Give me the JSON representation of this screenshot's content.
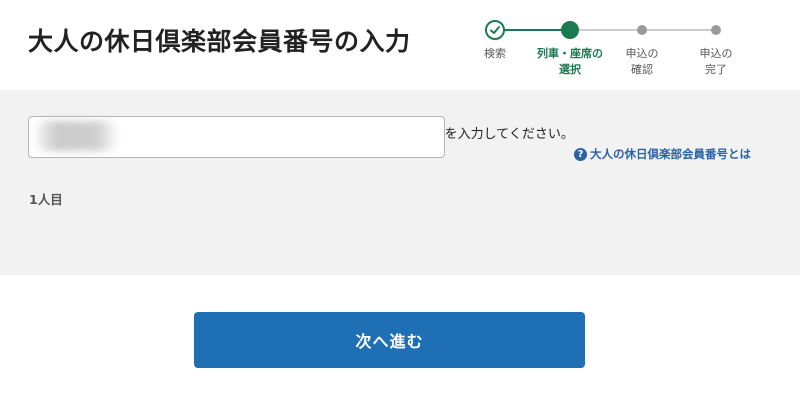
{
  "header": {
    "title": "大人の休日倶楽部会員番号の入力"
  },
  "stepper": {
    "accent_color": "#1a7a52",
    "steps": [
      {
        "label": "検索",
        "state": "done"
      },
      {
        "label": "列車・座席の\n選択",
        "state": "current"
      },
      {
        "label": "申込の\n確認",
        "state": "todo"
      },
      {
        "label": "申込の\n完了",
        "state": "todo"
      }
    ]
  },
  "form": {
    "instruction": "大人の休日倶楽部会員証（代理購入証明書）に記載されている会員番号を入力してください。",
    "help_link": "大人の休日倶楽部会員番号とは",
    "field_label": "1人目",
    "member_number_value": ""
  },
  "actions": {
    "next_label": "次へ進む",
    "button_color": "#1e6fb3"
  }
}
